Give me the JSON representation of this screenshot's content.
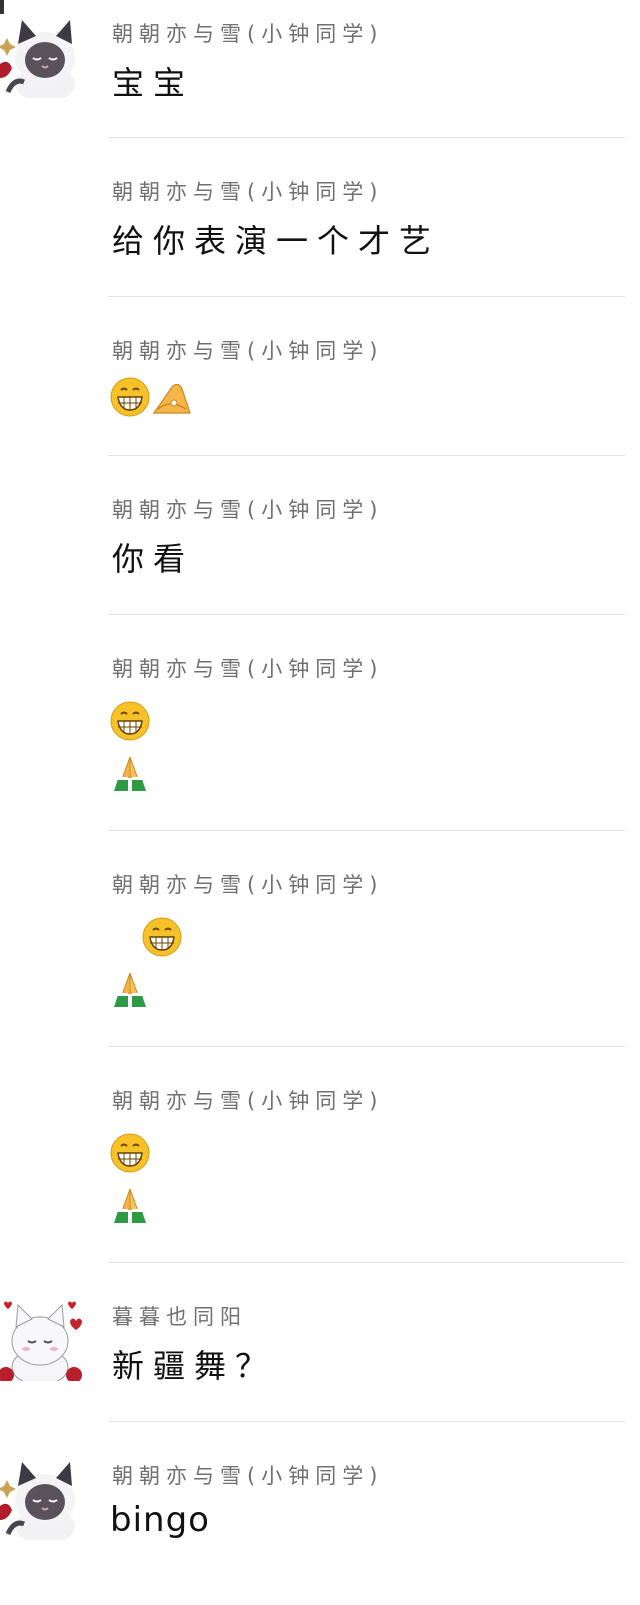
{
  "messages": [
    {
      "sender": "朝朝亦与雪(小钟同学)",
      "text": "宝宝"
    },
    {
      "sender": "朝朝亦与雪(小钟同学)",
      "text": "给你表演一个才艺"
    },
    {
      "sender": "朝朝亦与雪(小钟同学)",
      "emojis": [
        "grin-icon",
        "ok-hand-icon"
      ]
    },
    {
      "sender": "朝朝亦与雪(小钟同学)",
      "text": "你看"
    },
    {
      "sender": "朝朝亦与雪(小钟同学)",
      "emojis": [
        "grin-icon",
        "folded-hands-icon"
      ]
    },
    {
      "sender": "朝朝亦与雪(小钟同学)",
      "emojis": [
        "grin-icon",
        "folded-hands-icon"
      ]
    },
    {
      "sender": "朝朝亦与雪(小钟同学)",
      "emojis": [
        "grin-icon",
        "folded-hands-icon"
      ]
    },
    {
      "sender": "暮暮也同阳",
      "text": "新疆舞？"
    },
    {
      "sender": "朝朝亦与雪(小钟同学)",
      "text": "bingo"
    }
  ],
  "avatars": {
    "siamese_cat": "siamese-cat-avatar-icon",
    "white_cat": "white-cat-avatar-icon"
  },
  "colors": {
    "sender_text": "#707070",
    "message_text": "#111111",
    "divider": "#e4e4e4",
    "emoji_face": "#f7c12a",
    "sleeve_green": "#2f9a45"
  }
}
